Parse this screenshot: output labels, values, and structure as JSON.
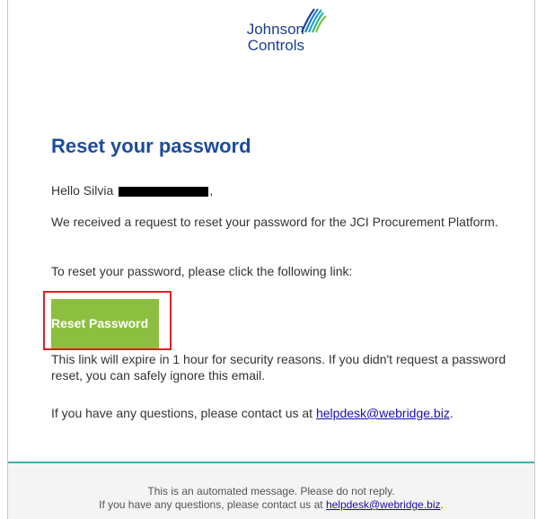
{
  "logo": {
    "line1": "Johnson",
    "line2": "Controls",
    "icon": "johnson-controls-logo-icon"
  },
  "headline": "Reset your password",
  "greeting": {
    "text": "Hello Silvia",
    "suffix": ","
  },
  "paragraph1": "We received a request to reset your password for the JCI Procurement Platform.",
  "paragraph2": "To reset your password, please click the following link:",
  "button": {
    "label": "Reset Password",
    "color": "#8cbf3f"
  },
  "paragraph3": "This link will expire in 1 hour for security reasons. If you didn't request a password reset, you can safely ignore this email.",
  "contact": {
    "text": "If you have any questions, please contact us at ",
    "email": "helpdesk@webridge.biz",
    "suffix": "."
  },
  "footer": {
    "line1": "This is an automated message. Please do not reply.",
    "line2_text": "If you have any questions, please contact us at ",
    "line2_email": "helpdesk@webridge.biz",
    "line2_suffix": "."
  },
  "colors": {
    "headline": "#1c4c9c",
    "accent_line": "#39b3a9",
    "highlight_box": "#e02020"
  }
}
